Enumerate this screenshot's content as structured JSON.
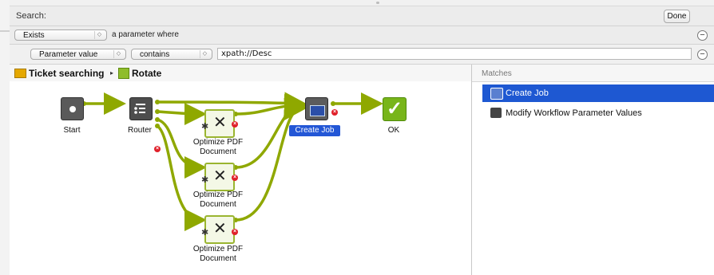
{
  "search_panel": {
    "title": "Search:",
    "done_label": "Done",
    "condition_row": {
      "scope_value": "Exists",
      "suffix_text": "a parameter where"
    },
    "criteria_row": {
      "field_value": "Parameter value",
      "operator_value": "contains",
      "query_value": "xpath://Desc"
    }
  },
  "breadcrumb": {
    "items": [
      {
        "label": "Ticket searching",
        "icon": "ticket-icon"
      },
      {
        "label": "Rotate",
        "icon": "flow-icon"
      }
    ],
    "separator": "▸"
  },
  "workflow": {
    "nodes": [
      {
        "id": "start",
        "label": "Start",
        "icon": "start-icon"
      },
      {
        "id": "router",
        "label": "Router",
        "icon": "router-icon"
      },
      {
        "id": "opt1",
        "label": "Optimize PDF Document",
        "icon": "tools-icon"
      },
      {
        "id": "opt2",
        "label": "Optimize PDF Document",
        "icon": "tools-icon"
      },
      {
        "id": "opt3",
        "label": "Optimize PDF Document",
        "icon": "tools-icon"
      },
      {
        "id": "createjob",
        "label": "Create Job",
        "icon": "job-icon",
        "selected": true
      },
      {
        "id": "ok",
        "label": "OK",
        "icon": "checkmark-icon"
      }
    ],
    "connector_color": "#8fa800"
  },
  "matches": {
    "header": "Matches",
    "items": [
      {
        "label": "Create Job",
        "selected": true,
        "icon": "job-icon"
      },
      {
        "label": "Modify Workflow Parameter Values",
        "selected": false,
        "icon": "modify-icon"
      }
    ],
    "selection_color": "#1e58d2"
  }
}
